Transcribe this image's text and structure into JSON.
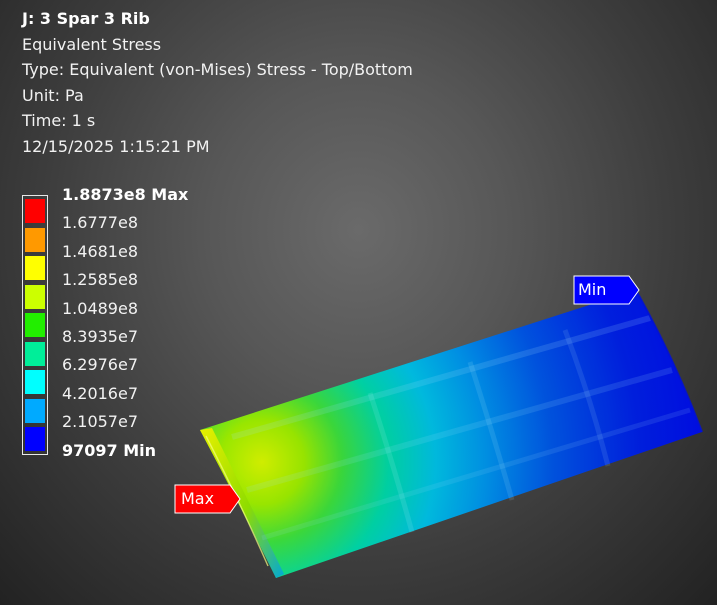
{
  "header": {
    "title": "J: 3 Spar 3 Rib",
    "result_name": "Equivalent Stress",
    "type": "Type: Equivalent (von-Mises) Stress - Top/Bottom",
    "unit": "Unit: Pa",
    "time": "Time: 1 s",
    "timestamp": "12/15/2025 1:15:21 PM"
  },
  "legend": {
    "labels": [
      "1.8873e8 Max",
      "1.6777e8",
      "1.4681e8",
      "1.2585e8",
      "1.0489e8",
      "8.3935e7",
      "6.2976e7",
      "4.2016e7",
      "2.1057e7",
      "97097 Min"
    ],
    "colors": [
      "#ff0000",
      "#ff9900",
      "#ffff00",
      "#ccff00",
      "#22ee00",
      "#00ee99",
      "#00ffff",
      "#00aaff",
      "#0000ff"
    ]
  },
  "probes": {
    "max_label": "Max",
    "max_color": "#ff0000",
    "min_label": "Min",
    "min_color": "#0000ff"
  }
}
